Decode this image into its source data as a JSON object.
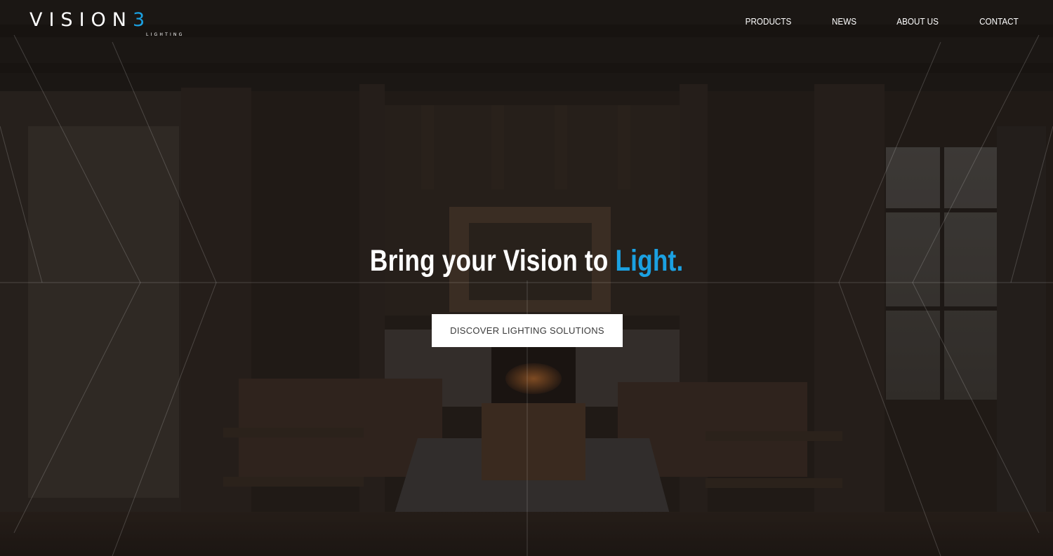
{
  "logo": {
    "word": "VISION",
    "number": "3",
    "subtitle": "LIGHTING"
  },
  "nav": {
    "items": [
      {
        "label": "PRODUCTS"
      },
      {
        "label": "NEWS"
      },
      {
        "label": "ABOUT US"
      },
      {
        "label": "CONTACT"
      }
    ]
  },
  "hero": {
    "headline_main": "Bring your Vision to ",
    "headline_accent": "Light.",
    "cta_label": "DISCOVER LIGHTING SOLUTIONS"
  },
  "colors": {
    "accent": "#1ba1e2",
    "overlay": "#1c1815",
    "button_bg": "#ffffff",
    "button_text": "#3a3a3a"
  }
}
